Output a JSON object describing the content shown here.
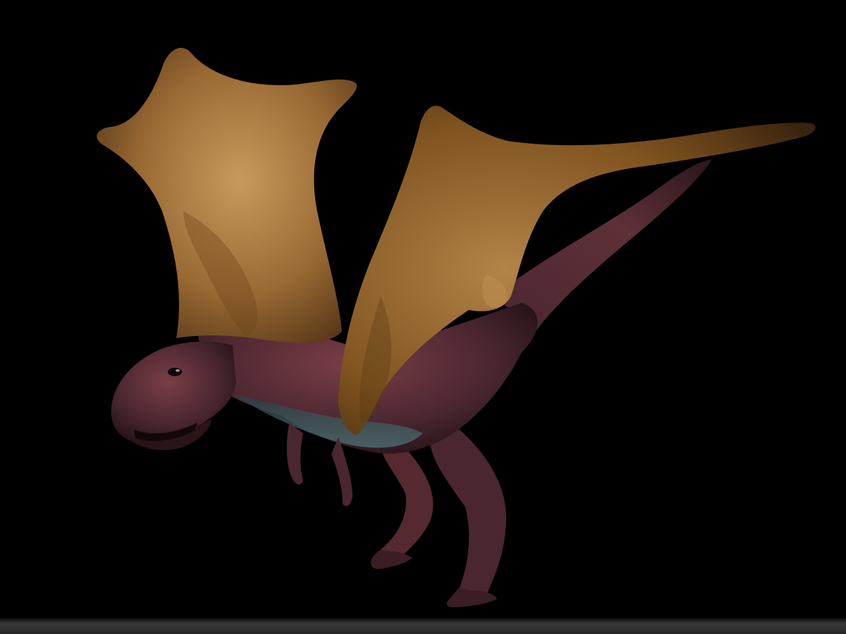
{
  "scene": {
    "subject": "winged-dinosaur-render",
    "background_color": "#000000",
    "colors": {
      "wing_light": "#b98a4e",
      "wing_mid": "#8a5a28",
      "wing_dark": "#3a2410",
      "skin_light": "#7a3e46",
      "skin_mid": "#4a2630",
      "skin_dark": "#1e1014",
      "underbelly": "#3e5a5c",
      "bottom_bar": "#2e2e2e"
    },
    "icons": {
      "creature": "dragon-icon"
    }
  }
}
